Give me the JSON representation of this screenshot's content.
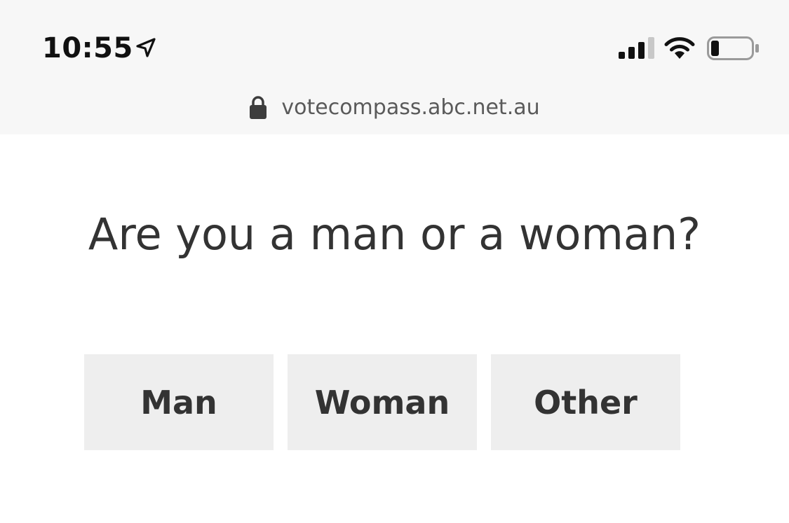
{
  "status_bar": {
    "time": "10:55",
    "location_icon": "location-arrow-icon",
    "signal_icon": "cellular-signal-icon",
    "wifi_icon": "wifi-icon",
    "battery_icon": "battery-icon",
    "battery_level": 0.2
  },
  "address_bar": {
    "lock_icon": "lock-icon",
    "url": "votecompass.abc.net.au"
  },
  "question": {
    "text": "Are you a man or a woman?"
  },
  "options": [
    {
      "label": "Man"
    },
    {
      "label": "Woman"
    },
    {
      "label": "Other"
    }
  ],
  "colors": {
    "chrome_background": "#f7f7f7",
    "button_background": "#eeeeee",
    "text": "#333333"
  }
}
